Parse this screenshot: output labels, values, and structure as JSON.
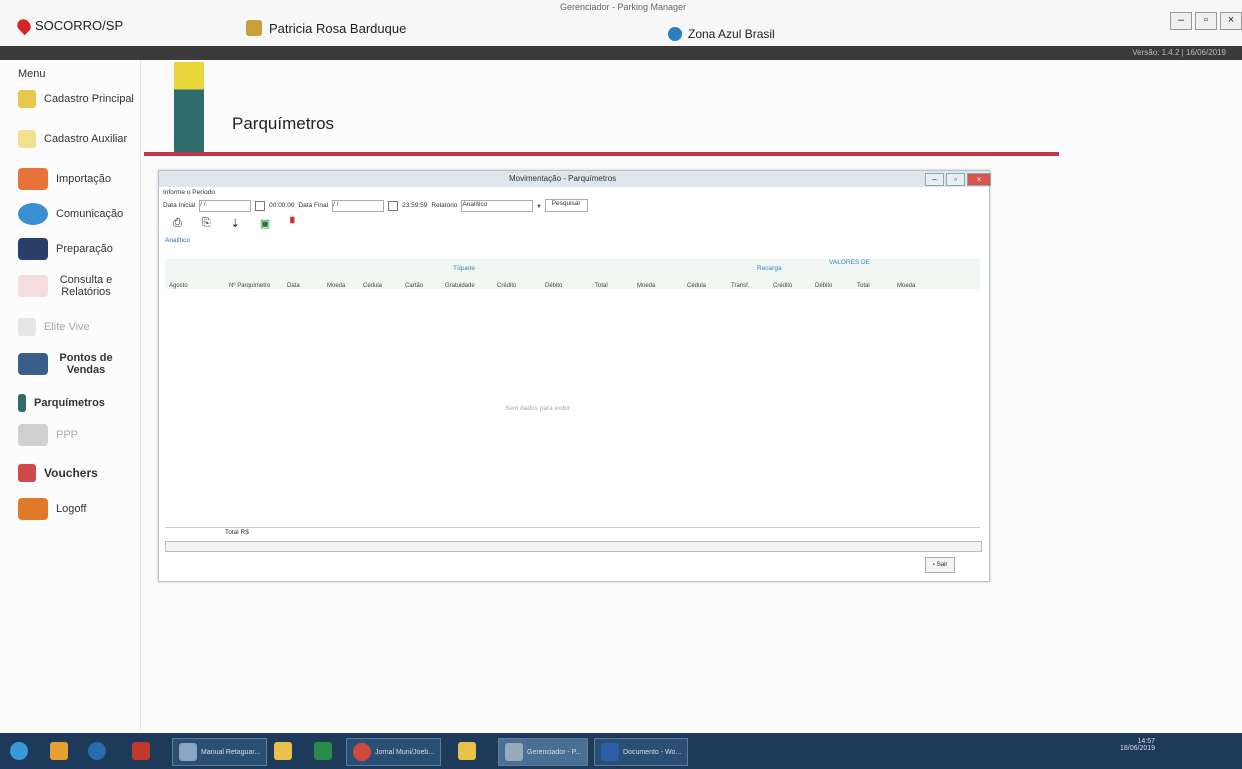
{
  "topbar": {
    "city": "SOCORRO/SP",
    "user": "Patricia Rosa Barduque",
    "app_title": "Gerenciador - Parking Manager",
    "company": "Zona Azul Brasil",
    "window_buttons": [
      "–",
      "▫",
      "×"
    ],
    "info": "Versão: 1.4.2  |  16/06/2019"
  },
  "menu": {
    "title": "Menu",
    "items": [
      {
        "label": "Cadastro Principal",
        "color": "#e6c84a"
      },
      {
        "label": "Cadastro Auxiliar",
        "color": "#e6c84a"
      },
      {
        "label": "Importação",
        "color": "#e8733a"
      },
      {
        "label": "Comunicação",
        "color": "#3a8fd0"
      },
      {
        "label": "Preparação",
        "color": "#2a3f6a"
      },
      {
        "label": "Consulta e Relatórios",
        "color": "#d04a4a"
      },
      {
        "label": "Elite Vive",
        "color": "#c8c8c8"
      },
      {
        "label": "Pontos de Vendas",
        "color": "#3a5d8a"
      },
      {
        "label": "Parquímetros",
        "color": "#2e6c6c"
      },
      {
        "label": "PPP",
        "color": "#b8b8b8"
      },
      {
        "label": "Vouchers",
        "color": "#d04a4a"
      },
      {
        "label": "Logoff",
        "color": "#e07a2a"
      }
    ]
  },
  "page": {
    "title": "Parquímetros"
  },
  "dialog": {
    "title": "Movimentação - Parquímetros",
    "section_label": "Informe o Período",
    "date_start_label": "Data Inicial",
    "date_start_value": "/ /",
    "time_start": "00:00:00",
    "date_end_label": "Data Final",
    "date_end_value": "/ /",
    "time_end": "23:59:59",
    "report_label": "Relatório",
    "report_value": "Analítico",
    "search_button": "Pesquisar",
    "mode_label": "Analítico",
    "group_tiquete": "Tíquete",
    "group_recarga": "Recarga",
    "group_valores": "VALORES DE",
    "columns": [
      "Agosto",
      "Nº Parquímetro",
      "Data",
      "Moeda",
      "Cédula",
      "Cartão",
      "Gratuidade",
      "Crédito",
      "Débito",
      "Total",
      "Moeda",
      "Cédula",
      "Transf.",
      "Crédito",
      "Débito",
      "Total",
      "Moeda"
    ],
    "empty_text": "Sem dados para exibir",
    "total_label": "Total R$",
    "close_button": "Sair"
  },
  "taskbar": {
    "items": [
      "Manual Retaguar...",
      "Jornal Muni/Joeb...",
      "Gerenciador - P...",
      "Documento - Wo..."
    ],
    "clock": "14:57",
    "date": "18/06/2019"
  }
}
